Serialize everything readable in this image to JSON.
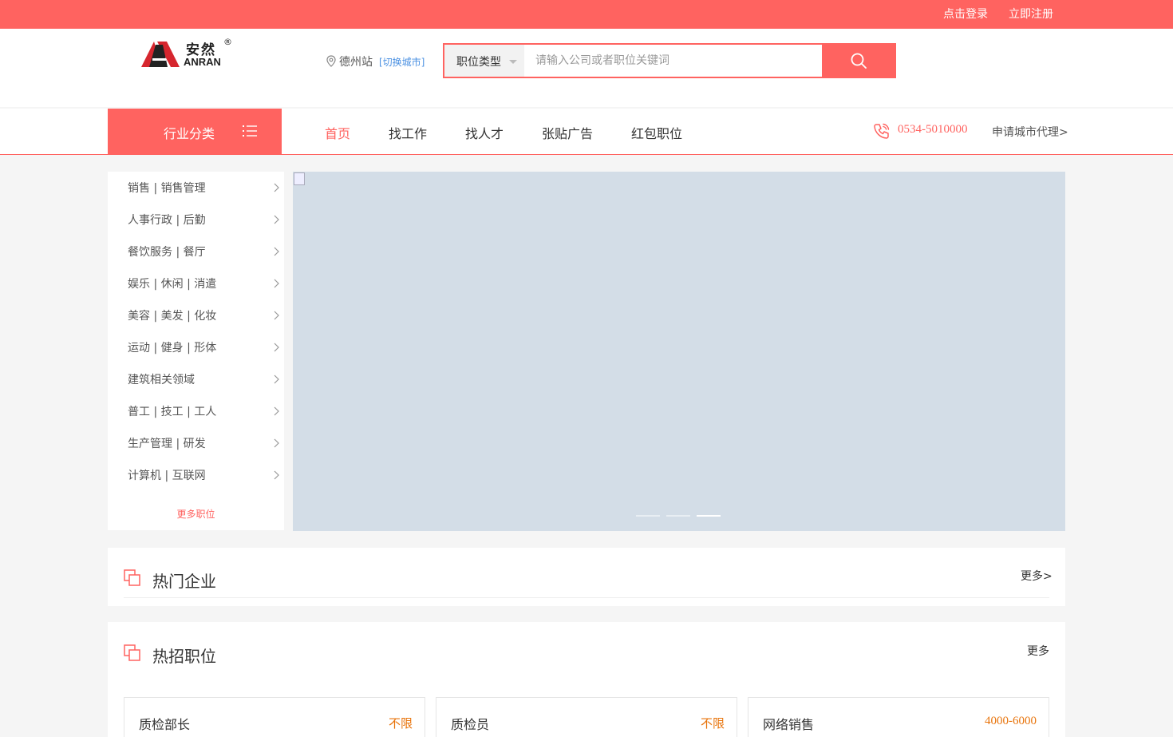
{
  "topbar": {
    "login": "点击登录",
    "register": "立即注册"
  },
  "logo": {
    "cn": "安然",
    "en": "ANRAN",
    "reg": "®"
  },
  "city": {
    "name": "德州站",
    "switch": "[切换城市]"
  },
  "search": {
    "type_label": "职位类型",
    "placeholder": "请输入公司或者职位关键词",
    "value": ""
  },
  "nav": {
    "category_label": "行业分类",
    "items": [
      {
        "label": "首页",
        "active": true
      },
      {
        "label": "找工作"
      },
      {
        "label": "找人才"
      },
      {
        "label": "张贴广告"
      },
      {
        "label": "红包职位"
      }
    ],
    "phone": "0534-5010000",
    "agent": "申请城市代理>"
  },
  "sidebar": {
    "items": [
      "销售 | 销售管理",
      "人事行政 | 后勤",
      "餐饮服务 | 餐厅",
      "娱乐 | 休闲 | 消遣",
      "美容 | 美发 | 化妆",
      "运动 | 健身 | 形体",
      "建筑相关领域",
      "普工 | 技工 | 工人",
      "生产管理 | 研发",
      "计算机 | 互联网"
    ],
    "more": "更多职位"
  },
  "banner": {
    "slide_count": 3,
    "active_slide": 3
  },
  "hot_companies": {
    "title": "热门企业",
    "more": "更多>"
  },
  "hot_jobs": {
    "title": "热招职位",
    "more": "更多",
    "jobs": [
      {
        "title": "质检部长",
        "salary": "不限"
      },
      {
        "title": "质检员",
        "salary": "不限"
      },
      {
        "title": "网络销售",
        "salary": "4000-6000"
      }
    ]
  },
  "colors": {
    "accent": "#ff6360",
    "salary": "#e8740c",
    "link": "#4a90e2",
    "banner_bg": "#d3dde7"
  }
}
